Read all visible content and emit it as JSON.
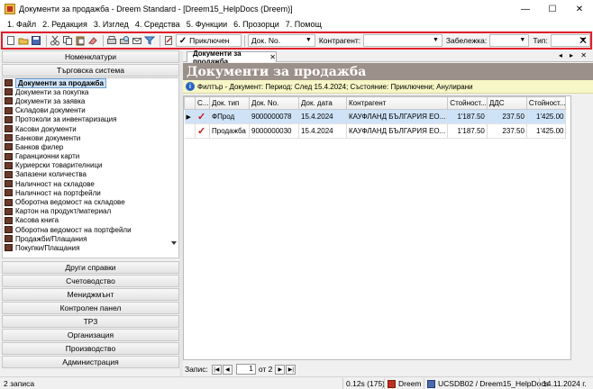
{
  "window": {
    "title": "Документи за продажба - Dreem Standard - [Dreem15_HelpDocs (Dreem)]",
    "minimize": "—",
    "maximize": "☐",
    "close": "✕"
  },
  "menu": [
    "1. Файл",
    "2. Редакция",
    "3. Изглед",
    "4. Средства",
    "5. Функции",
    "6. Прозорци",
    "7. Помощ"
  ],
  "toolbar": {
    "status_combo": "Приключен",
    "doc_no_combo": "Док. No.",
    "contragent_label": "Контрагент:",
    "note_label": "Забележка:",
    "type_label": "Тип:"
  },
  "left_panel": {
    "top_group": "Номенклатури",
    "active_group": "Търговска система",
    "nav_items": [
      "Документи за продажба",
      "Документи за покупка",
      "Документи за заявка",
      "Складови документи",
      "Протоколи за инвентаризация",
      "Касови документи",
      "Банкови документи",
      "Банков филер",
      "Гаранционни карти",
      "Куриерски товарителници",
      "Запазени количества",
      "Наличност на складове",
      "Наличност на портфейли",
      "Оборотна ведомост на складове",
      "Картон на продукт/материал",
      "Касова книга",
      "Оборотна ведомост на портфейли",
      "Продажби/Плащания",
      "Покупки/Плащания"
    ],
    "bottom_groups": [
      "Други справки",
      "Счетоводство",
      "Мениджмънт",
      "Контролен панел",
      "ТРЗ",
      "Организация",
      "Производство",
      "Администрация"
    ]
  },
  "tab": {
    "label": "Документи за продажба",
    "close": "✕",
    "controls": "◂ ▸ ✕"
  },
  "doc_header": "Документи за продажба",
  "filter": "Филтър - Документ: Период: След 15.4.2024; Състояние: Приключени; Анулирани",
  "grid": {
    "columns": [
      "С...",
      "Док. тип",
      "Док. No.",
      "Док. дата",
      "Контрагент",
      "Стойност...",
      "ДДС",
      "Стойност..."
    ],
    "rows": [
      {
        "type": "ФПрод",
        "no": "9000000078",
        "date": "15.4.2024",
        "contragent": "КАУФЛАНД БЪЛГАРИЯ ЕО...",
        "value": "1'187.50",
        "vat": "237.50",
        "total": "1'425.00"
      },
      {
        "type": "Продажба",
        "no": "9000000030",
        "date": "15.4.2024",
        "contragent": "КАУФЛАНД БЪЛГАРИЯ ЕО...",
        "value": "1'187.50",
        "vat": "237.50",
        "total": "1'425.00"
      }
    ]
  },
  "pager": {
    "label": "Запис:",
    "page": "1",
    "of": "от 2"
  },
  "status": {
    "records": "2 записа",
    "timing": "0.12s (175)",
    "app": "Dreem",
    "db": "UCSDB02 / Dreem15_HelpDocs",
    "date": "14.11.2024 г."
  }
}
